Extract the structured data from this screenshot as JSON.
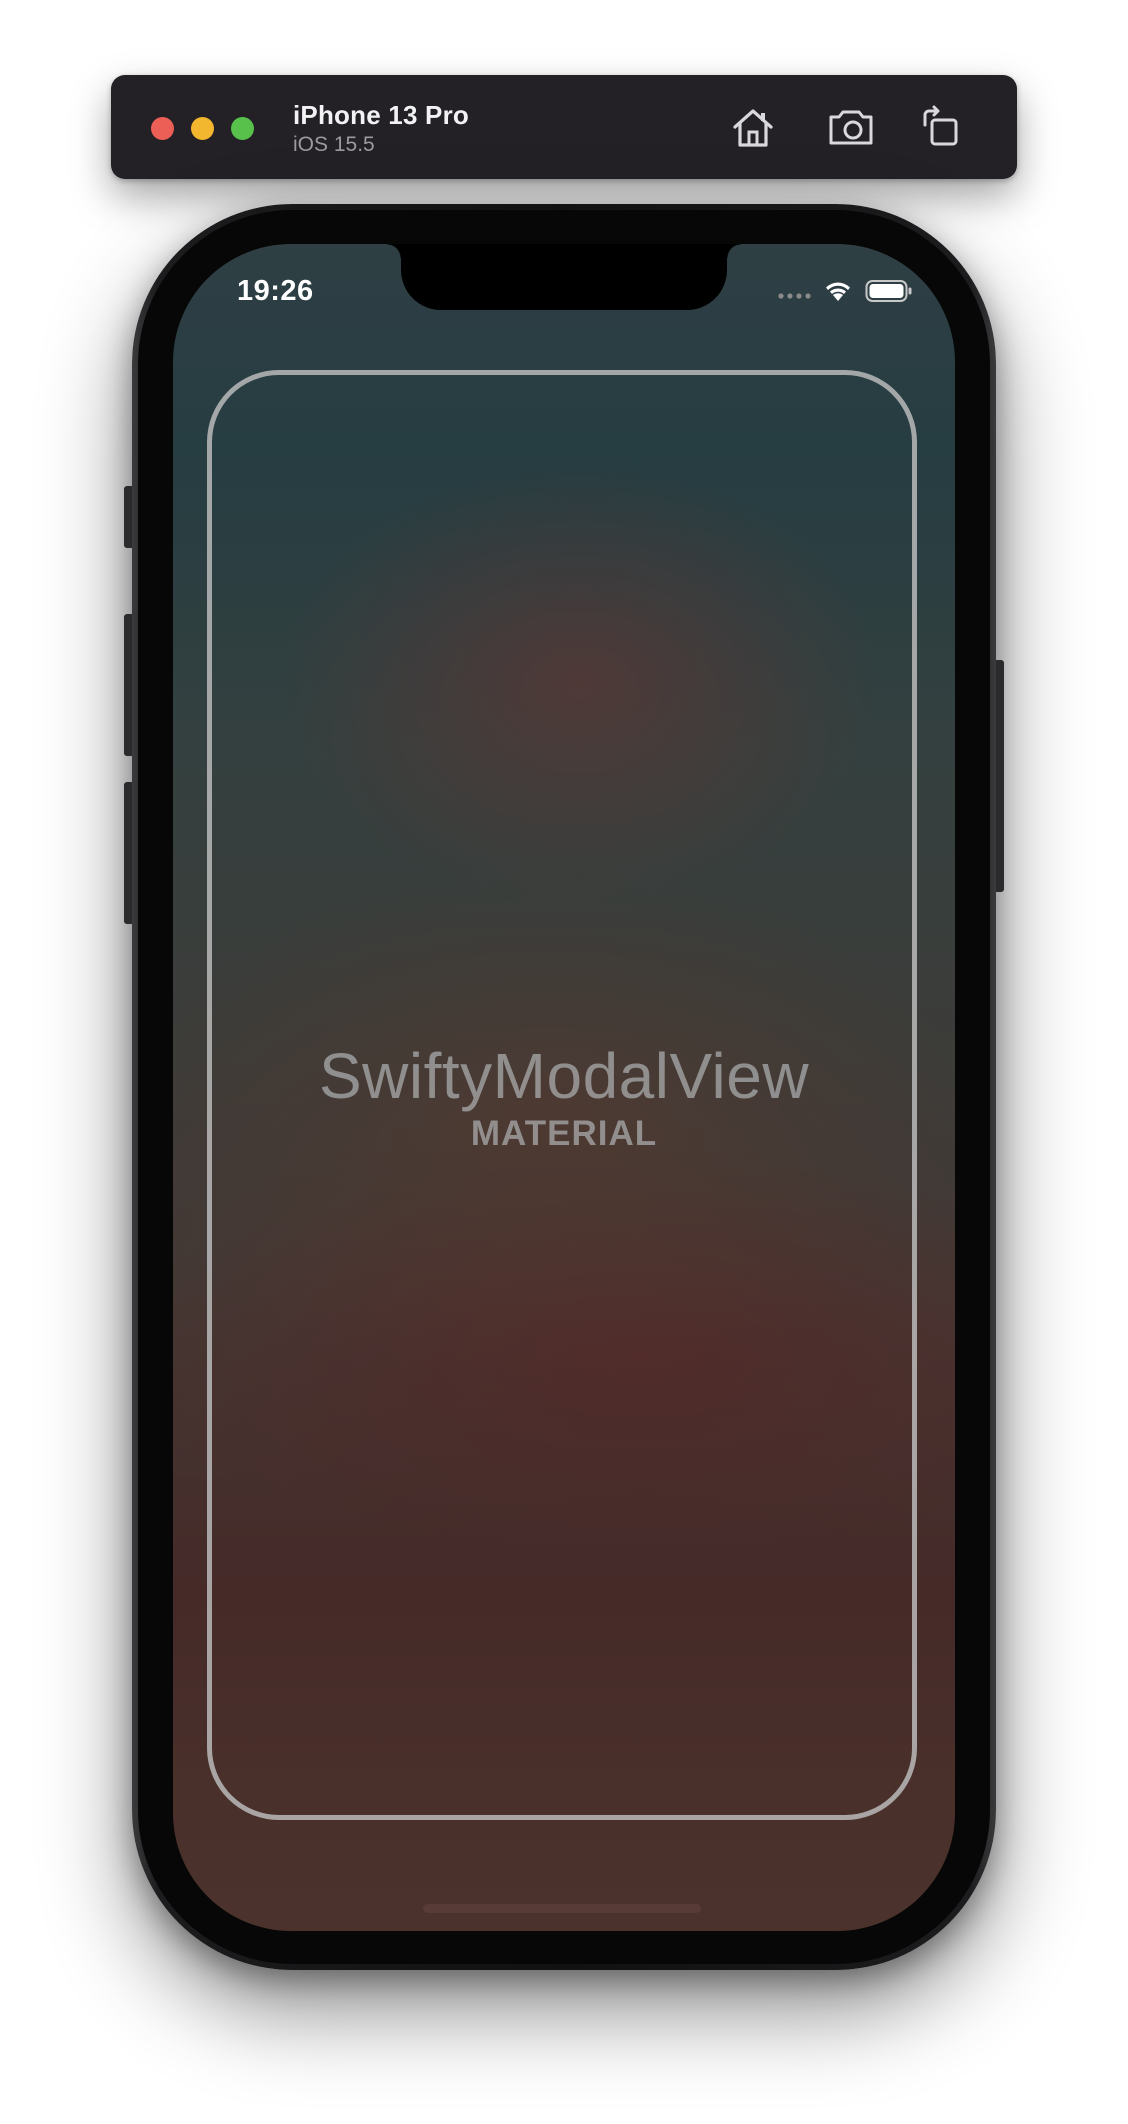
{
  "window": {
    "device_name": "iPhone 13 Pro",
    "os_version": "iOS 15.5",
    "toolbar_icons": [
      "home-icon",
      "screenshot-icon",
      "rotate-icon"
    ]
  },
  "status_bar": {
    "time": "19:26"
  },
  "content": {
    "title": "SwiftyModalView",
    "subtitle": "MATERIAL"
  },
  "colors": {
    "toolbar_bg": "#232126",
    "close": "#ec5f57",
    "minimize": "#f2b72f",
    "zoom": "#58c14c",
    "modal_outline": "#bababa"
  }
}
